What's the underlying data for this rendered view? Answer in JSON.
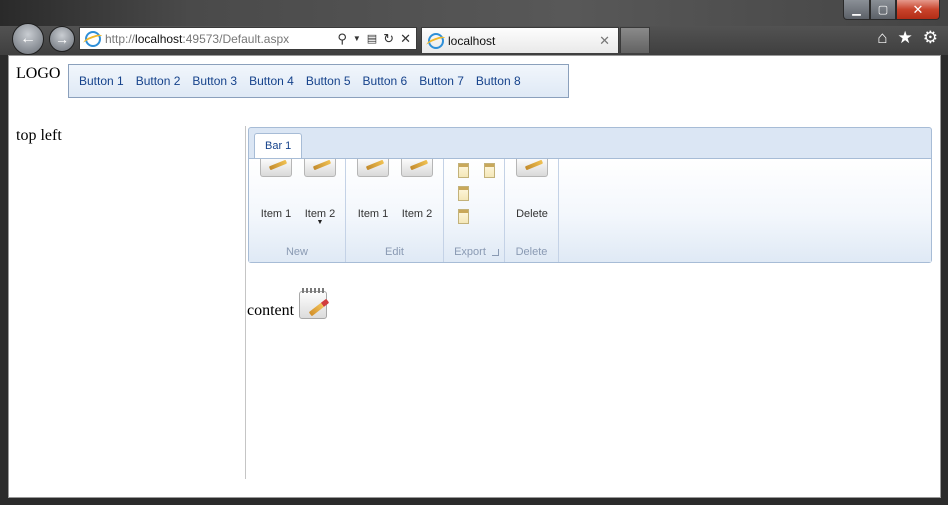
{
  "browser": {
    "address": {
      "scheme": "http://",
      "host": "localhost",
      "rest": ":49573/Default.aspx"
    },
    "tab_title": "localhost",
    "tab_close": "✕",
    "window": {
      "minimize": "▁",
      "maximize": "▢",
      "close": "✕"
    },
    "toolbar_icons": [
      "home-icon",
      "star-icon",
      "gear-icon"
    ]
  },
  "page": {
    "logo": "LOGO",
    "top_menu": [
      "Button 1",
      "Button 2",
      "Button 3",
      "Button 4",
      "Button 5",
      "Button 6",
      "Button 7",
      "Button 8"
    ],
    "top_left": "top left",
    "ribbon": {
      "tab": "Bar 1",
      "groups": {
        "new": {
          "label": "New",
          "items": [
            "Item 1",
            "Item 2"
          ]
        },
        "edit": {
          "label": "Edit",
          "items": [
            "Item 1",
            "Item 2"
          ]
        },
        "export": {
          "label": "Export"
        },
        "delete": {
          "label": "Delete",
          "items": [
            "Delete"
          ]
        }
      }
    },
    "content": "content"
  },
  "colors": {
    "menu_text": "#15428b",
    "ribbon_border": "#a7bcd6",
    "ribbon_bg": "#dbe6f4",
    "group_label": "#8a9ab3"
  }
}
